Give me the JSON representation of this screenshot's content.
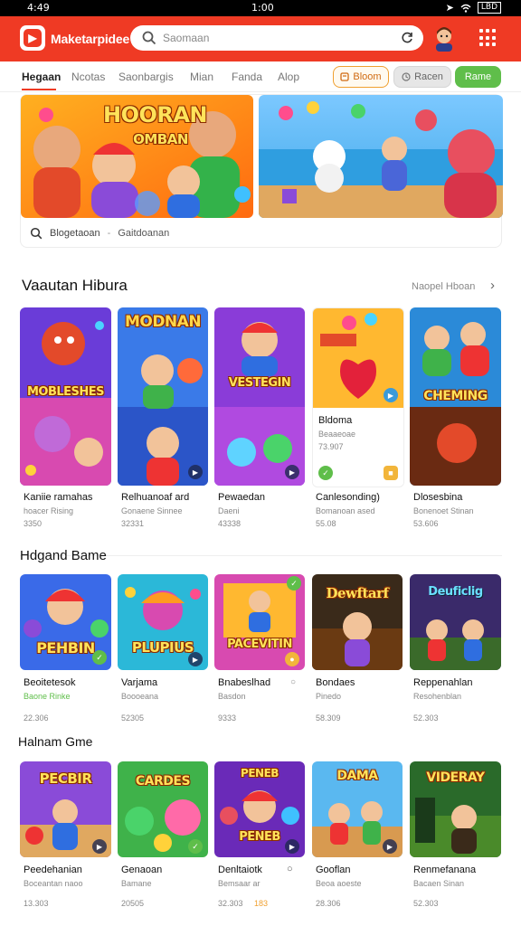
{
  "status_bar": {
    "time_left": "4:49",
    "time_center": "1:00",
    "battery": "LBD"
  },
  "header": {
    "app_name": "Maketarpidee",
    "search_placeholder": "Saomaan",
    "colors": {
      "brand": "#ef3a24"
    }
  },
  "tabs": {
    "items": [
      {
        "label": "Hegaan",
        "active": true
      },
      {
        "label": "Ncotas"
      },
      {
        "label": "Saonbargis"
      },
      {
        "label": "Mian"
      },
      {
        "label": "Fanda"
      },
      {
        "label": "Alop"
      }
    ],
    "pills": [
      {
        "label": "Bloom",
        "icon": "bookmark-icon"
      },
      {
        "label": "Racen",
        "icon": "clock-icon"
      },
      {
        "label": "Rame"
      }
    ]
  },
  "banners": {
    "left_text_line1": "HOORAN",
    "left_text_line2": "OMBAN",
    "footer_left": "Blogetaoan",
    "footer_sep": "-",
    "footer_right": "Gaitdoanan"
  },
  "section1": {
    "title": "Vaautan Hibura",
    "see_all": "Naopel Hboan",
    "cards": [
      {
        "art_text": "MOBLESHES",
        "title": "Kaniie ramahas",
        "sub": "hoacer Rising",
        "num": "3350"
      },
      {
        "art_text": "MODNAN",
        "title": "Relhuanoaf ard",
        "sub": "Gonaene Sinnee",
        "num": "32331"
      },
      {
        "art_text": "VESTEGIN",
        "title": "Pewaedan",
        "sub": "Daeni",
        "num": "43338"
      },
      {
        "art_text": "",
        "title": "Canlesonding)",
        "sub": "Bomanoan ased",
        "num": "55.08",
        "panel_title": "Bldoma",
        "panel_sub": "Beaaeoae",
        "panel_num": "73.907"
      },
      {
        "art_text": "CHEMING",
        "title": "Dlosesbina",
        "sub": "Bonenoet Stinan",
        "num": "53.606"
      }
    ]
  },
  "section2": {
    "title": "Hdgand Bame",
    "cards": [
      {
        "art_text": "PEHBIN",
        "title": "Beoitetesok",
        "sub": "Baone Rinke",
        "num": "22.306"
      },
      {
        "art_text": "PLUPIUS",
        "title": "Varjama",
        "sub": "Boooeana",
        "num": "52305"
      },
      {
        "art_text": "PACEVITIN",
        "title": "Bnabeslhad",
        "sub": "Basdon",
        "num": "9333"
      },
      {
        "art_text": "Dewftarf",
        "title": "Bondaes",
        "sub": "Pinedo",
        "num": "58.309"
      },
      {
        "art_text": "Deuficlig",
        "title": "Reppenahlan",
        "sub": "Resohenblan",
        "num": "52.303"
      }
    ]
  },
  "section3": {
    "title": "Halnam Gme",
    "cards": [
      {
        "art_text": "PECBIR",
        "title": "Peedehanian",
        "sub": "Boceantan naoo",
        "num": "13.303"
      },
      {
        "art_text": "CARDES",
        "title": "Genaoan",
        "sub": "Bamane",
        "num": "20505"
      },
      {
        "art_text": "PENEB",
        "title": "Denltaiotk",
        "sub": "Bemsaar ar",
        "num": "32.303",
        "num2": "183"
      },
      {
        "art_text": "DAMA",
        "title": "Gooflan",
        "sub": "Beoa aoeste",
        "num": "28.306"
      },
      {
        "art_text": "VIDERAY",
        "title": "Renmefanana",
        "sub": "Bacaen Sinan",
        "num": "52.303"
      }
    ]
  }
}
